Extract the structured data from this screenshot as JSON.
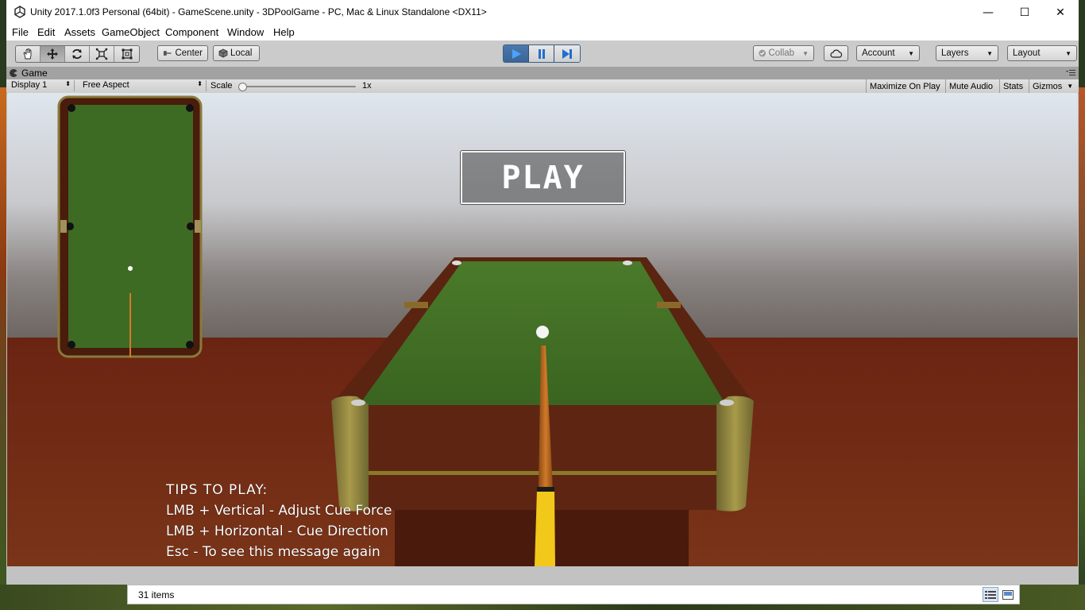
{
  "window": {
    "title": "Unity 2017.1.0f3 Personal (64bit) - GameScene.unity - 3DPoolGame - PC, Mac & Linux Standalone <DX11>",
    "controls": {
      "minimize": "—",
      "maximize": "☐",
      "close": "✕"
    }
  },
  "menu": [
    "File",
    "Edit",
    "Assets",
    "GameObject",
    "Component",
    "Window",
    "Help"
  ],
  "toolbar": {
    "transform_tools": [
      "hand-icon",
      "move-icon",
      "rotate-icon",
      "scale-icon",
      "rect-tool-icon"
    ],
    "pivot_label": "Center",
    "space_label": "Local",
    "collab_label": "Collab",
    "account_label": "Account",
    "layers_label": "Layers",
    "layout_label": "Layout",
    "play_controls": [
      "play-icon",
      "pause-icon",
      "step-icon"
    ]
  },
  "game_view": {
    "tab_label": "Game",
    "display": "Display 1",
    "aspect": "Free Aspect",
    "scale_label": "Scale",
    "scale_value": "1x",
    "maximize_on_play": "Maximize On Play",
    "mute_audio": "Mute Audio",
    "stats": "Stats",
    "gizmos": "Gizmos"
  },
  "game": {
    "play_button": "PLAY",
    "tips_heading": "TIPS TO PLAY:",
    "tips": [
      "LMB + Vertical - Adjust Cue Force",
      "LMB + Horizontal  - Cue Direction",
      "Esc - To see this message again"
    ]
  },
  "project_bar": {
    "item_count": "31 items"
  },
  "colors": {
    "felt": "#3e6b24",
    "wood": "#5a2410",
    "sky": "#d6dde6",
    "floor": "#6b2a14",
    "cue_yellow": "#f2c81a",
    "play_active": "#3a6598"
  }
}
